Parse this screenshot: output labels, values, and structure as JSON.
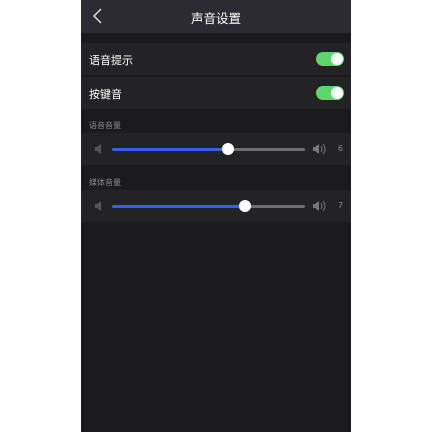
{
  "header": {
    "title": "声音设置",
    "back_icon": "chevron-left-icon"
  },
  "toggles": [
    {
      "label": "语音提示",
      "on": true
    },
    {
      "label": "按键音",
      "on": true
    }
  ],
  "sliders": [
    {
      "label": "语音音量",
      "value": "6",
      "fraction": 0.6
    },
    {
      "label": "媒体音量",
      "value": "7",
      "fraction": 0.69
    }
  ],
  "colors": {
    "toggle_on": "#5cd56d",
    "slider_fill": "#3a5cf0"
  }
}
